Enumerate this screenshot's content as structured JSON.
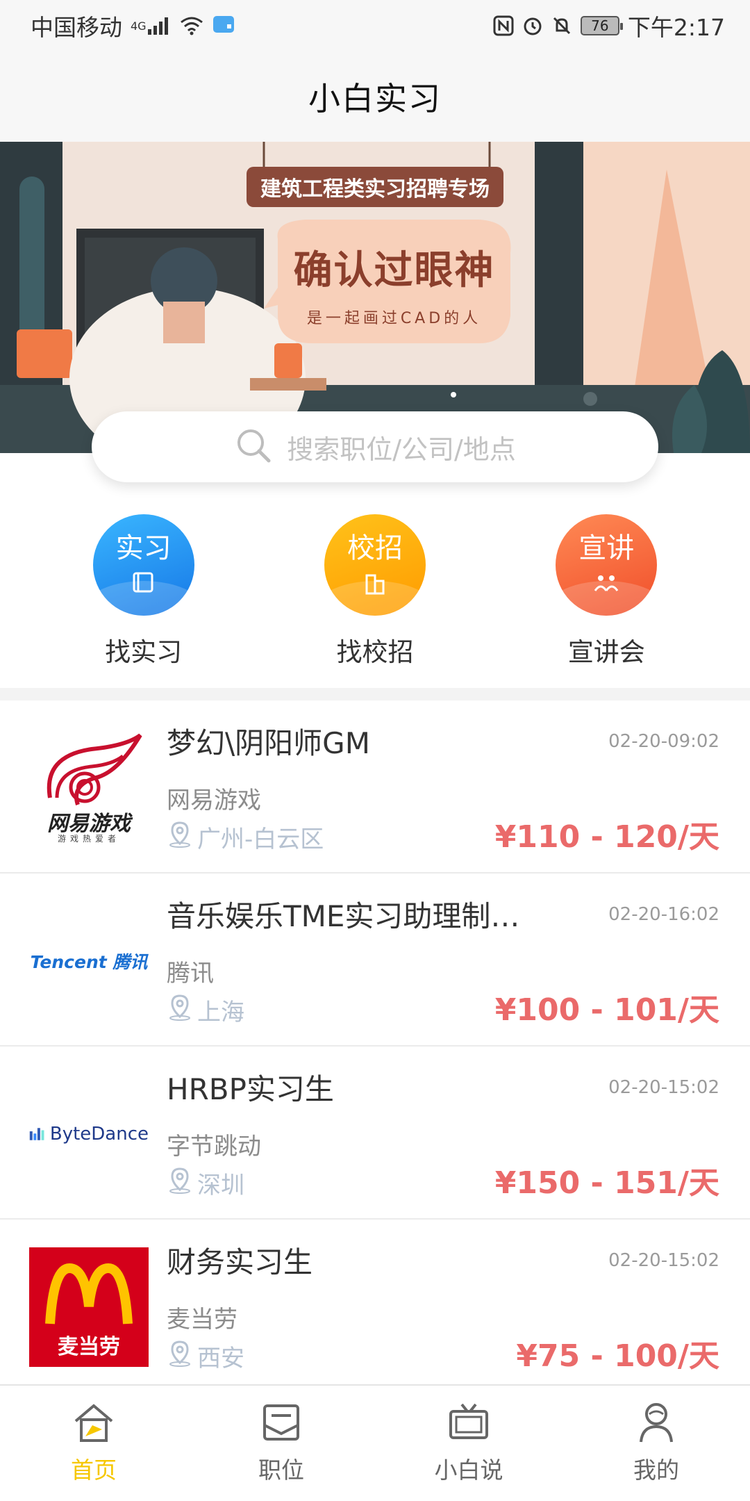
{
  "status": {
    "carrier": "中国移动",
    "network": "4G",
    "battery": "76",
    "time": "下午2:17"
  },
  "header": {
    "title": "小白实习"
  },
  "banner": {
    "sign": "建筑工程类实习招聘专场",
    "bubble_title": "确认过眼神",
    "bubble_sub": "是一起画过CAD的人"
  },
  "search": {
    "placeholder": "搜索职位/公司/地点"
  },
  "quick_actions": [
    {
      "circle": "实习",
      "label": "找实习",
      "color": "#1e8ff2",
      "icon": "book-icon"
    },
    {
      "circle": "校招",
      "label": "找校招",
      "color": "#ffae0f",
      "icon": "building-icon"
    },
    {
      "circle": "宣讲",
      "label": "宣讲会",
      "color": "#f4623b",
      "icon": "people-icon"
    }
  ],
  "jobs": [
    {
      "title": "梦幻\\阴阳师GM",
      "date": "02-20-09:02",
      "company": "网易游戏",
      "location": "广州-白云区",
      "salary": "¥110 - 120/天",
      "logo": "网易游戏",
      "logo_sub": "游戏热爱者"
    },
    {
      "title": "音乐娱乐TME实习助理制…",
      "date": "02-20-16:02",
      "company": "腾讯",
      "location": "上海",
      "salary": "¥100 - 101/天",
      "logo": "Tencent 腾讯"
    },
    {
      "title": "HRBP实习生",
      "date": "02-20-15:02",
      "company": "字节跳动",
      "location": "深圳",
      "salary": "¥150 - 151/天",
      "logo": "ByteDance"
    },
    {
      "title": "财务实习生",
      "date": "02-20-15:02",
      "company": "麦当劳",
      "location": "西安",
      "salary": "¥75 - 100/天",
      "logo": "麦当劳"
    }
  ],
  "tabs": [
    {
      "label": "首页",
      "icon": "home-icon",
      "active": true
    },
    {
      "label": "职位",
      "icon": "job-icon",
      "active": false
    },
    {
      "label": "小白说",
      "icon": "tv-icon",
      "active": false
    },
    {
      "label": "我的",
      "icon": "user-icon",
      "active": false
    }
  ],
  "colors": {
    "accent": "#f6c700",
    "salary": "#ea6a6a",
    "location": "#b6c2d1"
  }
}
